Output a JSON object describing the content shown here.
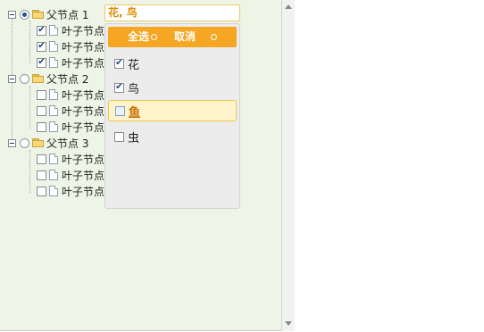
{
  "tree": {
    "parents": [
      {
        "label": "父节点 1",
        "radio_selected": true,
        "children": [
          {
            "label": "叶子节点",
            "checked": true
          },
          {
            "label": "叶子节点",
            "checked": true
          },
          {
            "label": "叶子节点",
            "checked": true
          }
        ]
      },
      {
        "label": "父节点 2",
        "radio_selected": false,
        "children": [
          {
            "label": "叶子节点",
            "checked": false
          },
          {
            "label": "叶子节点",
            "checked": false
          },
          {
            "label": "叶子节点",
            "checked": false
          }
        ]
      },
      {
        "label": "父节点 3",
        "radio_selected": false,
        "children": [
          {
            "label": "叶子节点",
            "checked": false
          },
          {
            "label": "叶子节点",
            "checked": false
          },
          {
            "label": "叶子节点",
            "checked": false
          }
        ]
      }
    ]
  },
  "select": {
    "value": "花, 鸟",
    "select_all_label": "全选",
    "cancel_label": "取消",
    "options": [
      {
        "label": "花",
        "checked": true
      },
      {
        "label": "鸟",
        "checked": true
      },
      {
        "label": "鱼",
        "checked": false,
        "highlighted": true
      },
      {
        "label": "虫",
        "checked": false
      }
    ]
  },
  "colors": {
    "accent": "#f5a623",
    "tree_bg": "#eef5e6",
    "highlight_bg": "#fff4cc"
  }
}
